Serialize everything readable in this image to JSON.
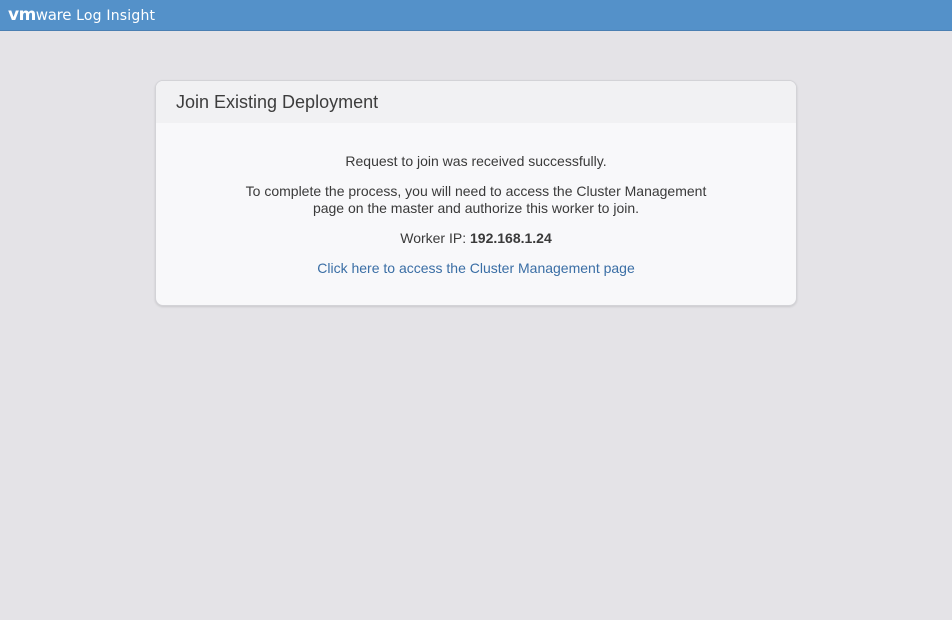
{
  "app": {
    "brand_vm": "vm",
    "brand_ware": "ware",
    "product": "Log Insight"
  },
  "panel": {
    "title": "Join Existing Deployment",
    "success_message": "Request to join was received successfully.",
    "instructions": "To complete the process, you will need to access the Cluster Management page on the master and authorize this worker to join.",
    "worker_ip_label": "Worker IP:",
    "worker_ip_value": "192.168.1.24",
    "cluster_link_text": "Click here to access the Cluster Management page"
  },
  "colors": {
    "topbar": "#5491c9",
    "background": "#e4e3e7",
    "link": "#3a6ea5"
  }
}
